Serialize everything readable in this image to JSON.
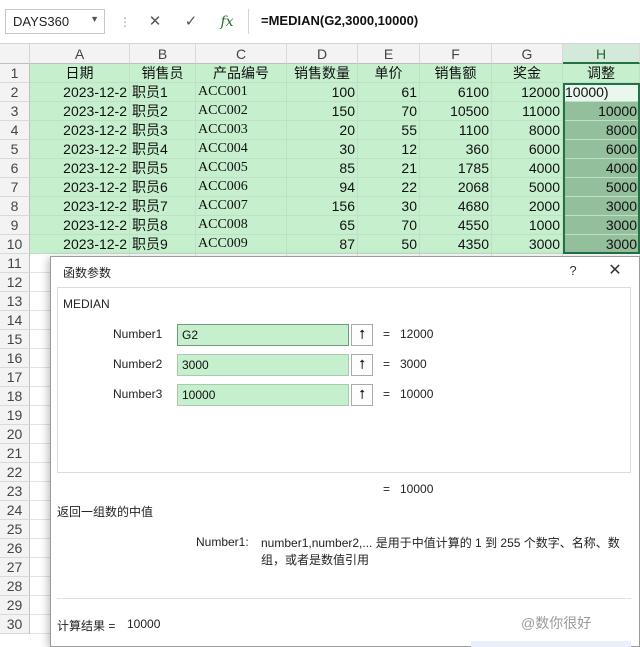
{
  "formula_bar": {
    "name_box": "DAYS360",
    "cancel_icon": "✕",
    "enter_icon": "✓",
    "fx_label": "fx",
    "formula": "=MEDIAN(G2,3000,10000)"
  },
  "columns": [
    "A",
    "B",
    "C",
    "D",
    "E",
    "F",
    "G",
    "H"
  ],
  "rows_visible": [
    "1",
    "2",
    "3",
    "4",
    "5",
    "6",
    "7",
    "8",
    "9",
    "10",
    "11",
    "12",
    "13",
    "14",
    "15",
    "16",
    "17",
    "18",
    "19",
    "20",
    "21",
    "22",
    "23",
    "24",
    "25",
    "26",
    "27",
    "28",
    "29",
    "30"
  ],
  "header_row": [
    "日期",
    "销售员",
    "产品编号",
    "销售数量",
    "单价",
    "销售额",
    "奖金",
    "调整"
  ],
  "table": [
    [
      "2023-12-2",
      "职员1",
      "ACC001",
      "100",
      "61",
      "6100",
      "12000",
      "10000)"
    ],
    [
      "2023-12-2",
      "职员2",
      "ACC002",
      "150",
      "70",
      "10500",
      "11000",
      "10000"
    ],
    [
      "2023-12-2",
      "职员3",
      "ACC003",
      "20",
      "55",
      "1100",
      "8000",
      "8000"
    ],
    [
      "2023-12-2",
      "职员4",
      "ACC004",
      "30",
      "12",
      "360",
      "6000",
      "6000"
    ],
    [
      "2023-12-2",
      "职员5",
      "ACC005",
      "85",
      "21",
      "1785",
      "4000",
      "4000"
    ],
    [
      "2023-12-2",
      "职员6",
      "ACC006",
      "94",
      "22",
      "2068",
      "5000",
      "5000"
    ],
    [
      "2023-12-2",
      "职员7",
      "ACC007",
      "156",
      "30",
      "4680",
      "2000",
      "3000"
    ],
    [
      "2023-12-2",
      "职员8",
      "ACC008",
      "65",
      "70",
      "4550",
      "1000",
      "3000"
    ],
    [
      "2023-12-2",
      "职员9",
      "ACC009",
      "87",
      "50",
      "4350",
      "3000",
      "3000"
    ]
  ],
  "dialog": {
    "title": "函数参数",
    "help": "?",
    "close": "✕",
    "function_name": "MEDIAN",
    "args": [
      {
        "label": "Number1",
        "value": "G2",
        "result": "12000"
      },
      {
        "label": "Number2",
        "value": "3000",
        "result": "3000"
      },
      {
        "label": "Number3",
        "value": "10000",
        "result": "10000"
      }
    ],
    "ref_icon": "⭡",
    "equals": "=",
    "formula_result": "10000",
    "description": "返回一组数的中值",
    "arg_name": "Number1:",
    "arg_description": "number1,number2,... 是用于中值计算的 1 到 255 个数字、名称、数组，或者是数值引用",
    "calc_label": "计算结果 =",
    "calc_value": "10000"
  },
  "watermark": "@数你很好",
  "colors": {
    "green_fill": "#c6efce",
    "selected_fill": "#94bf9c",
    "accent": "#217346"
  }
}
